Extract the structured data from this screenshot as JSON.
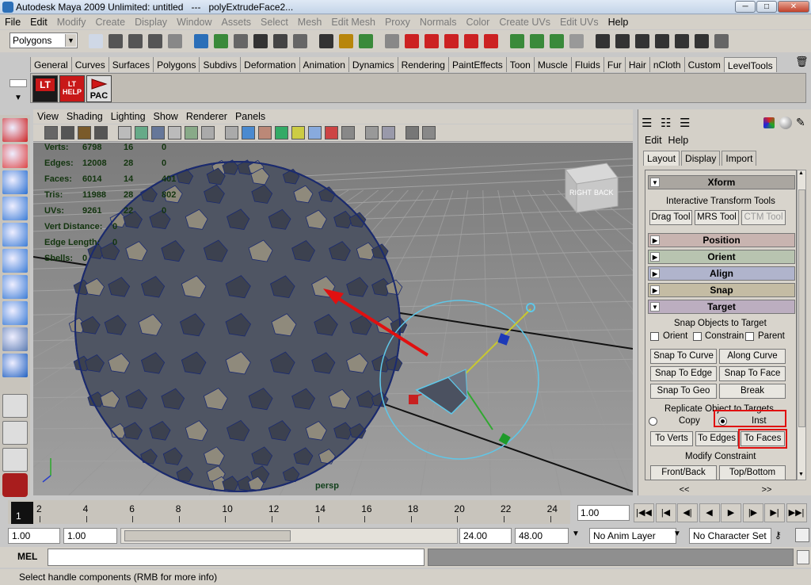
{
  "window": {
    "title": "Autodesk Maya 2009 Unlimited: untitled   ---   polyExtrudeFace2...",
    "minimize": "─",
    "maximize": "□",
    "close": "✕"
  },
  "menubar": [
    "File",
    "Edit",
    "Modify",
    "Create",
    "Display",
    "Window",
    "Assets",
    "Select",
    "Mesh",
    "Edit Mesh",
    "Proxy",
    "Normals",
    "Color",
    "Create UVs",
    "Edit UVs",
    "Help"
  ],
  "status_line": {
    "mode": "Polygons"
  },
  "shelf": {
    "tabs": [
      "General",
      "Curves",
      "Surfaces",
      "Polygons",
      "Subdivs",
      "Deformation",
      "Animation",
      "Dynamics",
      "Rendering",
      "PaintEffects",
      "Toon",
      "Muscle",
      "Fluids",
      "Fur",
      "Hair",
      "nCloth",
      "Custom",
      "LevelTools"
    ],
    "active_tab": "LevelTools",
    "buttons": [
      {
        "label": "LT",
        "icon": "lt-icon"
      },
      {
        "label": "LT\nHELP",
        "icon": "lt-help-icon"
      },
      {
        "label": "PAC",
        "icon": "pac-icon"
      }
    ]
  },
  "viewport": {
    "menu": [
      "View",
      "Shading",
      "Lighting",
      "Show",
      "Renderer",
      "Panels"
    ],
    "camera_label": "persp",
    "viewcube": {
      "right": "RIGHT",
      "back": "BACK"
    },
    "hud": [
      {
        "label": "Verts:",
        "v1": "6798",
        "v2": "16",
        "v3": "0"
      },
      {
        "label": "Edges:",
        "v1": "12008",
        "v2": "28",
        "v3": "0"
      },
      {
        "label": "Faces:",
        "v1": "6014",
        "v2": "14",
        "v3": "401"
      },
      {
        "label": "Tris:",
        "v1": "11988",
        "v2": "28",
        "v3": "802"
      },
      {
        "label": "UVs:",
        "v1": "9261",
        "v2": "22",
        "v3": "0"
      }
    ],
    "hud_extra": [
      {
        "label": "Vert Distance:",
        "value": "0"
      },
      {
        "label": "Edge Length:",
        "value": "0"
      },
      {
        "label": "Shells:",
        "value": "0"
      }
    ]
  },
  "right_panel": {
    "menu": [
      "Edit",
      "Help"
    ],
    "tabs": [
      "Layout",
      "Display",
      "Import"
    ],
    "active_tab": "Layout",
    "xform": "Xform",
    "interactive_title": "Interactive Transform Tools",
    "tool_buttons": [
      "Drag Tool",
      "MRS Tool",
      "CTM Tool"
    ],
    "sections": [
      {
        "label": "Position",
        "color": "#c8b4b0"
      },
      {
        "label": "Orient",
        "color": "#b8c4b0"
      },
      {
        "label": "Align",
        "color": "#b0b4cc"
      },
      {
        "label": "Snap",
        "color": "#c4bca4"
      },
      {
        "label": "Target",
        "color": "#bcaec0"
      }
    ],
    "snap_title": "Snap Objects to Target",
    "snap_checks": [
      "Orient",
      "Constrain",
      "Parent"
    ],
    "snap_buttons": [
      "Snap To Curve",
      "Along Curve",
      "Snap To Edge",
      "Snap To Face",
      "Snap To Geo",
      "Break"
    ],
    "replicate_title": "Replicate Object to Targets",
    "replicate_radios": [
      "Copy",
      "Inst"
    ],
    "replicate_selected": "Inst",
    "replicate_buttons": [
      "To Verts",
      "To Edges",
      "To Faces"
    ],
    "modify_title": "Modify Constraint",
    "modify_buttons": [
      "Front/Back",
      "Top/Bottom"
    ],
    "nav": [
      "<<",
      ">>"
    ]
  },
  "timeline": {
    "ticks": [
      "2",
      "4",
      "6",
      "8",
      "10",
      "12",
      "14",
      "16",
      "18",
      "20",
      "22",
      "24"
    ],
    "current_frame": "1",
    "playback_field": "1.00"
  },
  "range": {
    "start": "1.00",
    "playback_start": "1.00",
    "playback_end": "24.00",
    "end": "48.00",
    "anim_layer": "No Anim Layer",
    "character_set": "No Character Set"
  },
  "command_line": {
    "label": "MEL"
  },
  "help_line": "Select handle components (RMB for more info)",
  "colors": {
    "annotation_red": "#e01010",
    "maya_gray": "#d4d0c8",
    "mesh_dark": "#4a4f5c",
    "mesh_light": "#8e8e8e",
    "manipulator_blue": "#5fc7e8"
  }
}
